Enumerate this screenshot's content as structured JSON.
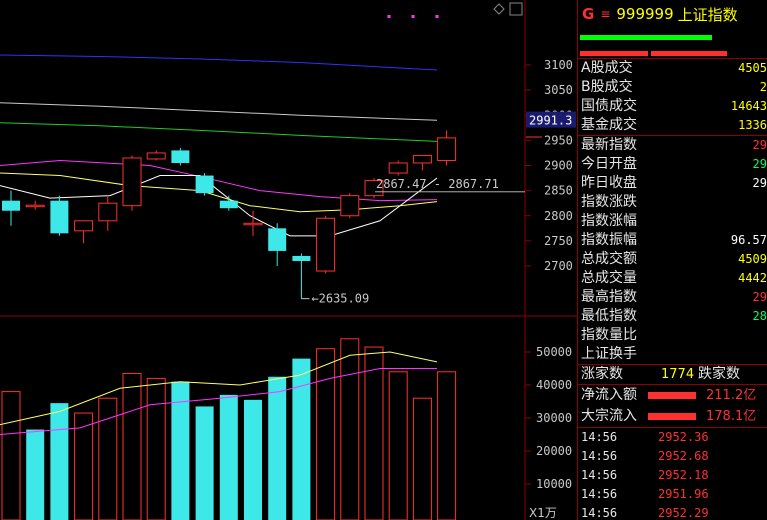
{
  "chart_data": {
    "type": "candlestick",
    "price_axis": {
      "ticks": [
        3100,
        3050,
        3000,
        2950,
        2900,
        2850,
        2800,
        2750,
        2700
      ],
      "range": [
        2600,
        3150
      ]
    },
    "volume_axis": {
      "ticks": [
        50000,
        40000,
        30000,
        20000,
        10000
      ],
      "range": [
        0,
        60000
      ],
      "unit_label": "X1万"
    },
    "current_price_label": "2991.3",
    "annotations": {
      "range_label": "2867.47 - 2867.71",
      "low_label": "2635.09"
    },
    "candles": [
      {
        "o": 2830,
        "h": 2850,
        "l": 2780,
        "c": 2810
      },
      {
        "o": 2820,
        "h": 2830,
        "l": 2812,
        "c": 2821
      },
      {
        "o": 2830,
        "h": 2840,
        "l": 2760,
        "c": 2765
      },
      {
        "o": 2770,
        "h": 2790,
        "l": 2745,
        "c": 2790
      },
      {
        "o": 2790,
        "h": 2840,
        "l": 2770,
        "c": 2825
      },
      {
        "o": 2820,
        "h": 2920,
        "l": 2810,
        "c": 2915
      },
      {
        "o": 2913,
        "h": 2930,
        "l": 2910,
        "c": 2925
      },
      {
        "o": 2930,
        "h": 2935,
        "l": 2900,
        "c": 2905
      },
      {
        "o": 2880,
        "h": 2885,
        "l": 2840,
        "c": 2845
      },
      {
        "o": 2830,
        "h": 2840,
        "l": 2810,
        "c": 2815
      },
      {
        "o": 2785,
        "h": 2810,
        "l": 2760,
        "c": 2785
      },
      {
        "o": 2775,
        "h": 2785,
        "l": 2700,
        "c": 2730
      },
      {
        "o": 2720,
        "h": 2725,
        "l": 2635,
        "c": 2710
      },
      {
        "o": 2690,
        "h": 2800,
        "l": 2685,
        "c": 2795
      },
      {
        "o": 2800,
        "h": 2845,
        "l": 2795,
        "c": 2840
      },
      {
        "o": 2840,
        "h": 2875,
        "l": 2835,
        "c": 2870
      },
      {
        "o": 2885,
        "h": 2910,
        "l": 2880,
        "c": 2905
      },
      {
        "o": 2905,
        "h": 2920,
        "l": 2890,
        "c": 2920
      },
      {
        "o": 2910,
        "h": 2970,
        "l": 2900,
        "c": 2955
      }
    ],
    "volumes": [
      {
        "v": 38000,
        "up": true
      },
      {
        "v": 26500,
        "up": false
      },
      {
        "v": 34500,
        "up": false
      },
      {
        "v": 31500,
        "up": true
      },
      {
        "v": 36000,
        "up": true
      },
      {
        "v": 43500,
        "up": true
      },
      {
        "v": 42000,
        "up": true
      },
      {
        "v": 41000,
        "up": false
      },
      {
        "v": 33500,
        "up": false
      },
      {
        "v": 37000,
        "up": false
      },
      {
        "v": 35500,
        "up": false
      },
      {
        "v": 42500,
        "up": false
      },
      {
        "v": 48000,
        "up": false
      },
      {
        "v": 51000,
        "up": true
      },
      {
        "v": 54000,
        "up": true
      },
      {
        "v": 51500,
        "up": true
      },
      {
        "v": 44000,
        "up": true
      },
      {
        "v": 36000,
        "up": true
      },
      {
        "v": 44000,
        "up": true
      }
    ],
    "ma_lines": [
      {
        "color": "#3030ff",
        "points": [
          [
            0,
            3120
          ],
          [
            100,
            3117
          ],
          [
            200,
            3112
          ],
          [
            300,
            3105
          ],
          [
            437,
            3090
          ]
        ]
      },
      {
        "color": "#c8c8c8",
        "points": [
          [
            0,
            3025
          ],
          [
            100,
            3018
          ],
          [
            200,
            3009
          ],
          [
            300,
            3000
          ],
          [
            437,
            2990
          ]
        ]
      },
      {
        "color": "#22cc22",
        "points": [
          [
            0,
            2985
          ],
          [
            100,
            2979
          ],
          [
            200,
            2970
          ],
          [
            300,
            2960
          ],
          [
            437,
            2948
          ]
        ]
      },
      {
        "color": "#ff33ff",
        "points": [
          [
            0,
            2900
          ],
          [
            60,
            2910
          ],
          [
            150,
            2900
          ],
          [
            200,
            2878
          ],
          [
            260,
            2850
          ],
          [
            320,
            2838
          ],
          [
            380,
            2830
          ],
          [
            437,
            2832
          ]
        ]
      },
      {
        "color": "#ffff66",
        "points": [
          [
            0,
            2885
          ],
          [
            60,
            2880
          ],
          [
            130,
            2860
          ],
          [
            200,
            2850
          ],
          [
            250,
            2820
          ],
          [
            300,
            2808
          ],
          [
            350,
            2812
          ],
          [
            400,
            2820
          ],
          [
            437,
            2828
          ]
        ]
      },
      {
        "color": "#ffffff",
        "points": [
          [
            0,
            2860
          ],
          [
            50,
            2835
          ],
          [
            110,
            2840
          ],
          [
            160,
            2880
          ],
          [
            200,
            2880
          ],
          [
            250,
            2800
          ],
          [
            290,
            2760
          ],
          [
            330,
            2760
          ],
          [
            380,
            2790
          ],
          [
            437,
            2875
          ]
        ]
      }
    ],
    "vol_ma_lines": [
      {
        "color": "#ffff66",
        "points": [
          [
            0,
            28000
          ],
          [
            60,
            32000
          ],
          [
            120,
            39000
          ],
          [
            180,
            41000
          ],
          [
            240,
            40000
          ],
          [
            300,
            43000
          ],
          [
            350,
            49000
          ],
          [
            390,
            50000
          ],
          [
            437,
            47000
          ]
        ]
      },
      {
        "color": "#ff33ff",
        "points": [
          [
            0,
            25000
          ],
          [
            80,
            27000
          ],
          [
            150,
            34000
          ],
          [
            220,
            36000
          ],
          [
            280,
            38000
          ],
          [
            330,
            42000
          ],
          [
            380,
            45000
          ],
          [
            437,
            45000
          ]
        ]
      }
    ]
  },
  "header": {
    "group": "G",
    "menu": "≡",
    "code": "999999",
    "name": "上证指数"
  },
  "header_bars": [
    {
      "color": "#00ff00",
      "frac": 0.14
    },
    {
      "color": "#00ff00",
      "frac": 0.56
    },
    {
      "color": "#ff3030",
      "frac": 0.36
    },
    {
      "color": "#ff3030",
      "frac": 0.4
    }
  ],
  "stats_top": [
    {
      "label": "A股成交",
      "value": "4505",
      "color": "yellow"
    },
    {
      "label": "B股成交",
      "value": "2",
      "color": "yellow"
    },
    {
      "label": "国债成交",
      "value": "14643",
      "color": "yellow"
    },
    {
      "label": "基金成交",
      "value": "1336",
      "color": "yellow"
    }
  ],
  "stats_mid": [
    {
      "label": "最新指数",
      "value": "29",
      "color": "red"
    },
    {
      "label": "今日开盘",
      "value": "29",
      "color": "green"
    },
    {
      "label": "昨日收盘",
      "value": "29",
      "color": "white"
    },
    {
      "label": "指数涨跌",
      "value": "",
      "color": "red"
    },
    {
      "label": "指数涨幅",
      "value": "",
      "color": "red"
    },
    {
      "label": "指数振幅",
      "value": "96.57",
      "color": "white"
    },
    {
      "label": "总成交额",
      "value": "4509",
      "color": "yellow"
    },
    {
      "label": "总成交量",
      "value": "4442",
      "color": "yellow"
    },
    {
      "label": "最高指数",
      "value": "29",
      "color": "red"
    },
    {
      "label": "最低指数",
      "value": "28",
      "color": "green"
    },
    {
      "label": "指数量比",
      "value": "",
      "color": "white"
    },
    {
      "label": "上证换手",
      "value": "",
      "color": "white"
    }
  ],
  "advance": {
    "label": "涨家数",
    "count": "1774",
    "decline_label": "跌家数"
  },
  "flows": [
    {
      "label": "净流入额",
      "value": "211.2亿"
    },
    {
      "label": "大宗流入",
      "value": "178.1亿"
    }
  ],
  "ticks": [
    {
      "time": "14:56",
      "price": "2952.36"
    },
    {
      "time": "14:56",
      "price": "2952.68"
    },
    {
      "time": "14:56",
      "price": "2952.18"
    },
    {
      "time": "14:56",
      "price": "2951.96"
    },
    {
      "time": "14:56",
      "price": "2952.29"
    }
  ]
}
